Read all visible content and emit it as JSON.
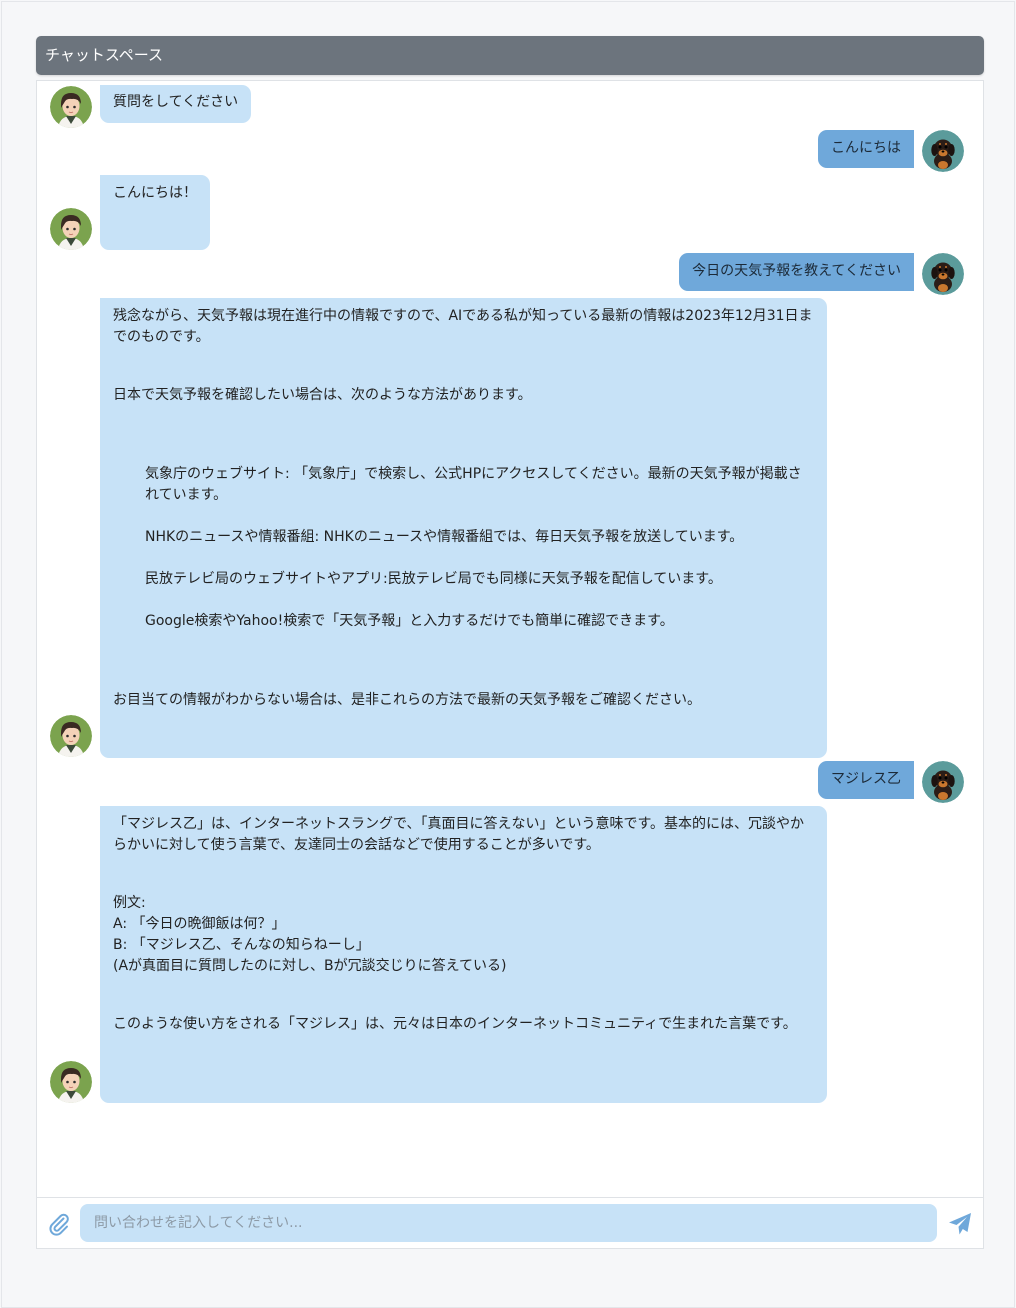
{
  "header": {
    "title": "チャットスペース"
  },
  "messages": [
    {
      "role": "bot",
      "paragraphs": [
        "質問をしてください"
      ]
    },
    {
      "role": "user",
      "text": "こんにちは"
    },
    {
      "role": "bot",
      "paragraphs": [
        "こんにちは！"
      ]
    },
    {
      "role": "user",
      "text": "今日の天気予報を教えてください"
    },
    {
      "role": "bot",
      "paragraphs": [
        "残念ながら、天気予報は現在進行中の情報ですので、AIである私が知っている最新の情報は2023年12月31日までのものです。",
        "日本で天気予報を確認したい場合は、次のような方法があります。",
        "気象庁のウェブサイト: 「気象庁」で検索し、公式HPにアクセスしてください。最新の天気予報が掲載されています。",
        "NHKのニュースや情報番組: NHKのニュースや情報番組では、毎日天気予報を放送しています。",
        "民放テレビ局のウェブサイトやアプリ:民放テレビ局でも同様に天気予報を配信しています。",
        "Google検索やYahoo!検索で「天気予報」と入力するだけでも簡単に確認できます。",
        "お目当ての情報がわからない場合は、是非これらの方法で最新の天気予報をご確認ください。"
      ]
    },
    {
      "role": "user",
      "text": "マジレス乙"
    },
    {
      "role": "bot",
      "paragraphs": [
        "「マジレス乙」は、インターネットスラングで、「真面目に答えない」という意味です。基本的には、冗談やからかいに対して使う言葉で、友達同士の会話などで使用することが多いです。",
        "例文:",
        "A: 「今日の晩御飯は何？」",
        "B: 「マジレス乙、そんなの知らねーし」",
        "(Aが真面目に質問したのに対し、Bが冗談交じりに答えている)",
        "このような使い方をされる「マジレス」は、元々は日本のインターネットコミュニティで生まれた言葉です。"
      ]
    }
  ],
  "input": {
    "placeholder": "問い合わせを記入してください..."
  },
  "icons": {
    "attach": "paperclip-icon",
    "send": "paper-plane-icon"
  },
  "colors": {
    "header": "#6c747d",
    "bot_bubble": "#c7e2f7",
    "user_bubble": "#6fa8da",
    "icon": "#6fa8da"
  }
}
